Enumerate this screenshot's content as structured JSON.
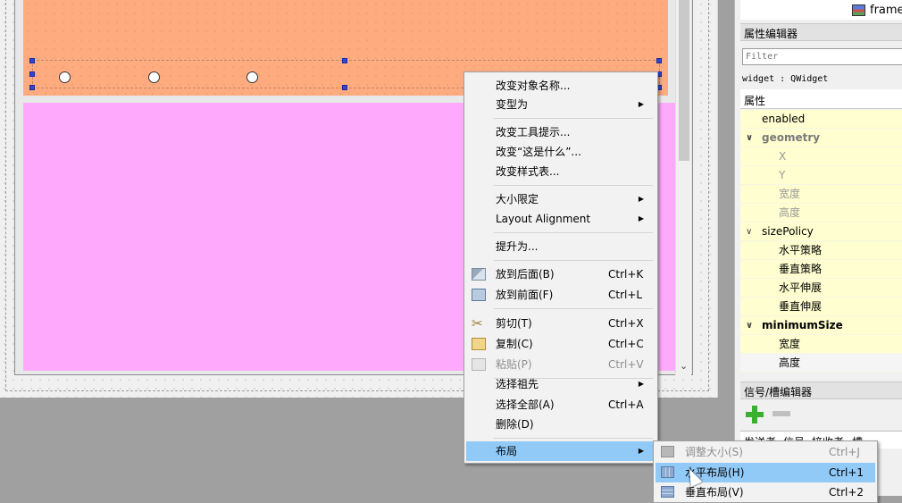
{
  "dock": {
    "object_row_label": "frame",
    "property_editor_title": "属性编辑器",
    "filter_placeholder": "Filter",
    "widget_line": "widget : QWidget",
    "property_column_header": "属性",
    "properties": [
      {
        "label": "enabled"
      },
      {
        "label": "geometry"
      },
      {
        "label": "X"
      },
      {
        "label": "Y"
      },
      {
        "label": "宽度"
      },
      {
        "label": "高度"
      },
      {
        "label": "sizePolicy"
      },
      {
        "label": "水平策略"
      },
      {
        "label": "垂直策略"
      },
      {
        "label": "水平伸展"
      },
      {
        "label": "垂直伸展"
      },
      {
        "label": "minimumSize"
      },
      {
        "label": "宽度"
      },
      {
        "label": "高度"
      }
    ],
    "signal_slot_title": "信号/槽编辑器",
    "signal_headers": [
      "发送者",
      "信号",
      "接收者",
      "槽"
    ]
  },
  "context_menu": {
    "items": [
      {
        "label": "改变对象名称..."
      },
      {
        "label": "变型为",
        "has_submenu": true
      },
      {
        "label": "改变工具提示..."
      },
      {
        "label": "改变“这是什么”..."
      },
      {
        "label": "改变样式表..."
      },
      {
        "label": "大小限定",
        "has_submenu": true
      },
      {
        "label": "Layout Alignment",
        "has_submenu": true
      },
      {
        "label": "提升为..."
      },
      {
        "label": "放到后面(B)",
        "shortcut": "Ctrl+K",
        "icon": "send-to-back-icon"
      },
      {
        "label": "放到前面(F)",
        "shortcut": "Ctrl+L",
        "icon": "bring-to-front-icon"
      },
      {
        "label": "剪切(T)",
        "shortcut": "Ctrl+X",
        "icon": "scissors-icon"
      },
      {
        "label": "复制(C)",
        "shortcut": "Ctrl+C",
        "icon": "copy-icon"
      },
      {
        "label": "粘贴(P)",
        "shortcut": "Ctrl+V",
        "icon": "paste-icon",
        "disabled": true
      },
      {
        "label": "选择祖先",
        "has_submenu": true
      },
      {
        "label": "选择全部(A)",
        "shortcut": "Ctrl+A"
      },
      {
        "label": "删除(D)"
      },
      {
        "label": "布局",
        "has_submenu": true,
        "highlighted": true
      }
    ]
  },
  "layout_submenu": {
    "items": [
      {
        "label": "调整大小(S)",
        "shortcut": "Ctrl+J",
        "icon": "adjust-size-icon",
        "disabled": true
      },
      {
        "label": "水平布局(H)",
        "shortcut": "Ctrl+1",
        "icon": "horizontal-layout-icon",
        "highlighted": true
      },
      {
        "label": "垂直布局(V)",
        "shortcut": "Ctrl+2",
        "icon": "vertical-layout-icon"
      }
    ]
  },
  "colors": {
    "orange_frame": "#ffab80",
    "pink_frame": "#ffa9fd",
    "menu_highlight": "#91c9f7"
  }
}
